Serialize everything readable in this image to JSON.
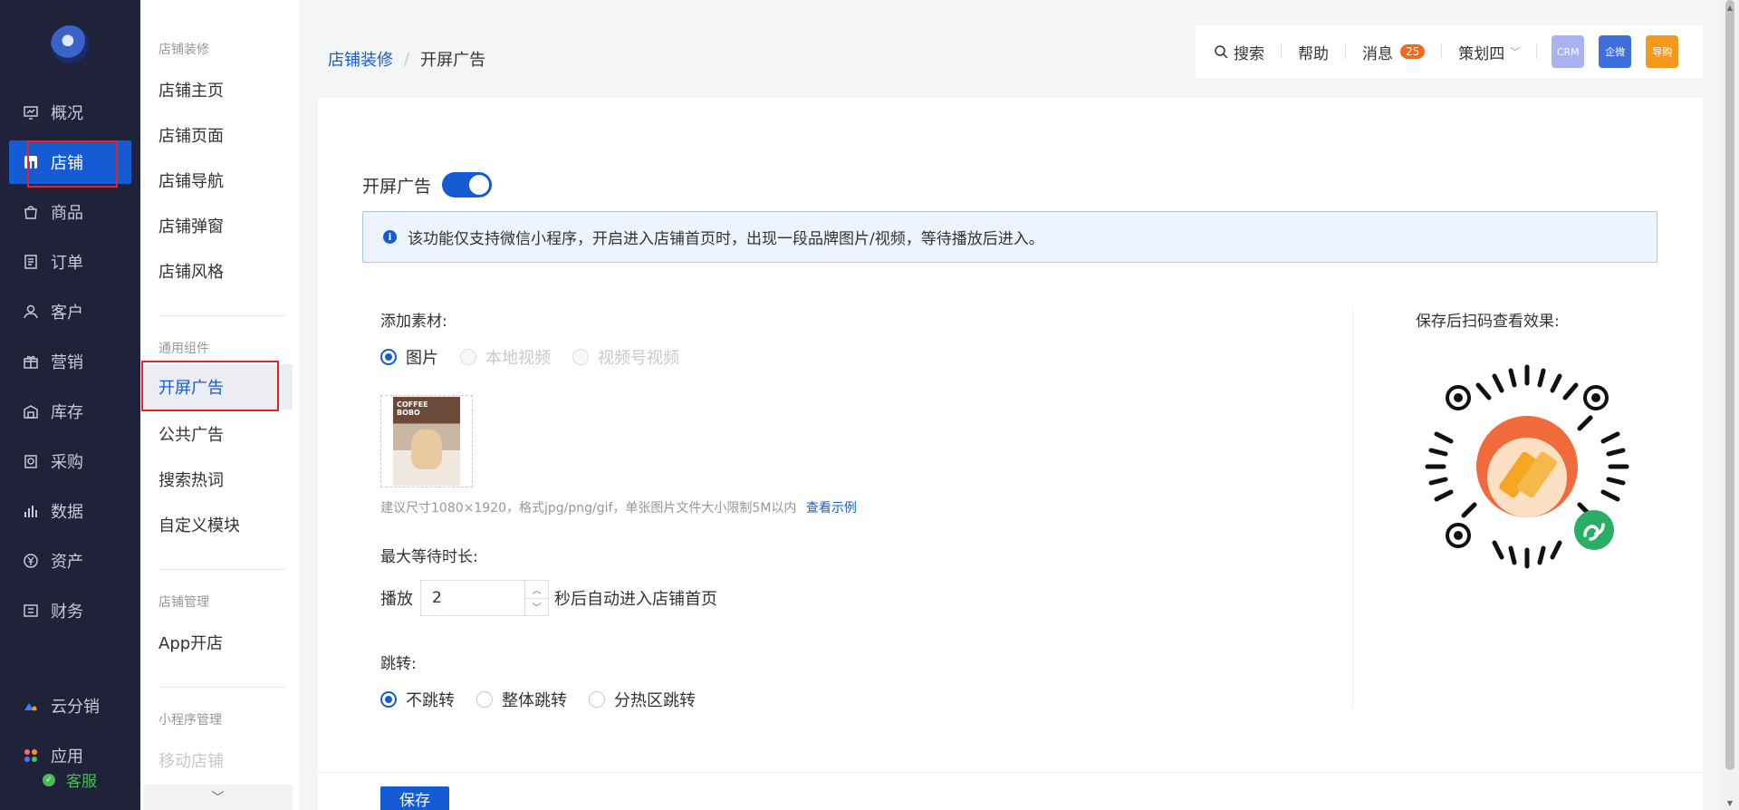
{
  "primary_nav": {
    "items": [
      {
        "label": "概况",
        "icon": "overview-icon"
      },
      {
        "label": "店铺",
        "icon": "store-icon",
        "active": true
      },
      {
        "label": "商品",
        "icon": "bag-icon"
      },
      {
        "label": "订单",
        "icon": "order-icon"
      },
      {
        "label": "客户",
        "icon": "customer-icon"
      },
      {
        "label": "营销",
        "icon": "gift-icon"
      },
      {
        "label": "库存",
        "icon": "warehouse-icon"
      },
      {
        "label": "采购",
        "icon": "purchase-icon"
      },
      {
        "label": "数据",
        "icon": "chart-icon"
      },
      {
        "label": "资产",
        "icon": "yen-icon"
      },
      {
        "label": "财务",
        "icon": "finance-icon"
      }
    ],
    "bottom": [
      {
        "label": "云分销",
        "icon": "cloud-distribution-icon"
      },
      {
        "label": "应用",
        "icon": "apps-icon"
      }
    ],
    "service_label": "客服"
  },
  "secondary_nav": {
    "groups": [
      {
        "title": "店铺装修",
        "items": [
          "店铺主页",
          "店铺页面",
          "店铺导航",
          "店铺弹窗",
          "店铺风格"
        ]
      },
      {
        "title": "通用组件",
        "items": [
          "开屏广告",
          "公共广告",
          "搜索热词",
          "自定义模块"
        ]
      },
      {
        "title": "店铺管理",
        "items": [
          "App开店"
        ]
      },
      {
        "title": "小程序管理",
        "items": [
          "移动店铺"
        ]
      }
    ]
  },
  "breadcrumb": {
    "parent": "店铺装修",
    "separator": "/",
    "current": "开屏广告"
  },
  "topbar": {
    "search": "搜索",
    "help": "帮助",
    "messages": "消息",
    "message_count": "25",
    "user": "策划四",
    "apps": [
      {
        "label": "CRM",
        "color": "#a8b3f0"
      },
      {
        "label": "企微",
        "color": "#3f6fd8"
      },
      {
        "label": "导购",
        "color": "#f39a1e"
      }
    ]
  },
  "form": {
    "toggle_label": "开屏广告",
    "toggle_on": true,
    "notice": "该功能仅支持微信小程序，开启进入店铺首页时，出现一段品牌图片/视频，等待播放后进入。",
    "material_label": "添加素材:",
    "material_options": [
      "图片",
      "本地视频",
      "视频号视频"
    ],
    "thumb_caption": "COFFEE BOBO",
    "hint": "建议尺寸1080×1920，格式jpg/png/gif，单张图片文件大小限制5M以内",
    "hint_link": "查看示例",
    "wait_label": "最大等待时长:",
    "play_prefix": "播放",
    "wait_value": "2",
    "play_suffix": "秒后自动进入店铺首页",
    "jump_label": "跳转:",
    "jump_options": [
      "不跳转",
      "整体跳转",
      "分热区跳转"
    ],
    "qr_title": "保存后扫码查看效果:",
    "save_label": "保存"
  },
  "colors": {
    "primary": "#155bd4",
    "sidebar_bg": "#1f2238",
    "badge": "#ee6a1c",
    "highlight": "#e8202a"
  }
}
